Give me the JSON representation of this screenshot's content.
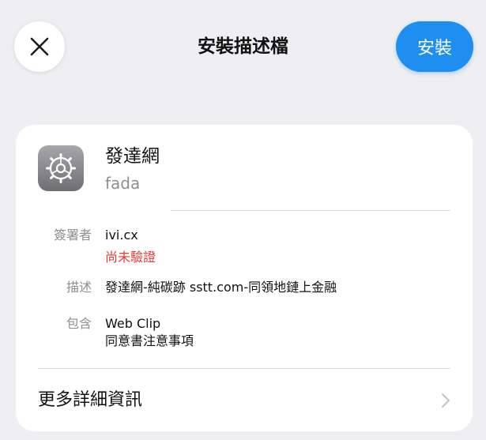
{
  "header": {
    "title": "安裝描述檔",
    "install_label": "安裝"
  },
  "profile": {
    "name": "發達網",
    "subtitle": "fada",
    "icon": "settings-gear-icon"
  },
  "details": {
    "signer_label": "簽署者",
    "signer_value": "ivi.cx",
    "signer_status": "尚未驗證",
    "description_label": "描述",
    "description_value": "發達網-純碳跡 sstt.com-同領地鏈上金融",
    "contains_label": "包含",
    "contains_items": [
      "Web Clip",
      "同意書注意事項"
    ]
  },
  "more": {
    "label": "更多詳細資訊"
  },
  "colors": {
    "accent": "#1f8ef1",
    "warning": "#e53935",
    "background": "#efeff3"
  }
}
